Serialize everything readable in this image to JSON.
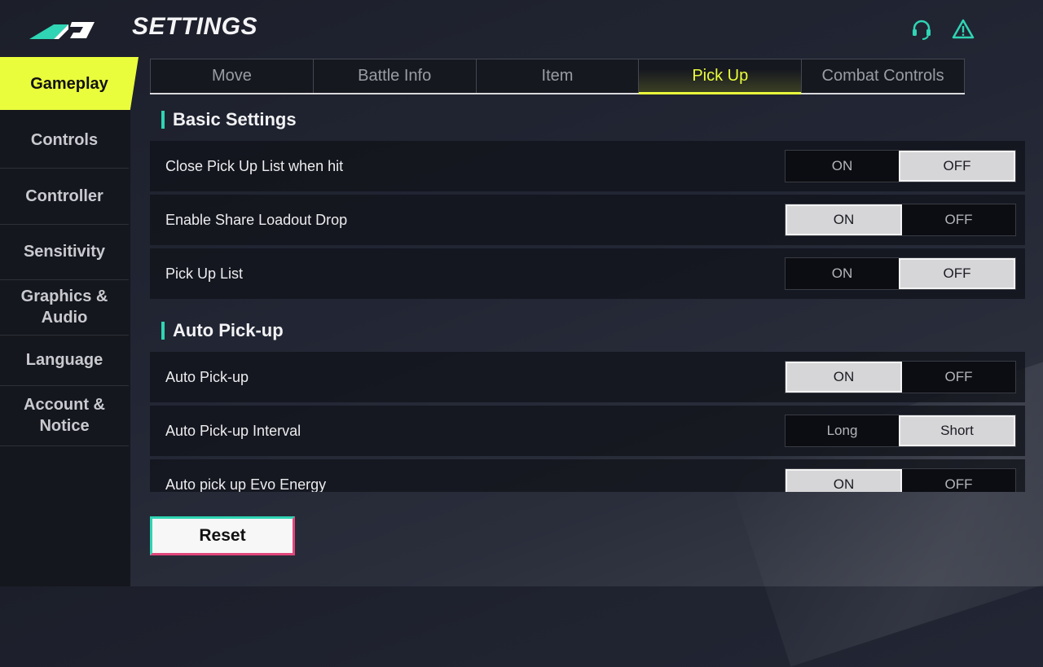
{
  "header": {
    "title": "SETTINGS",
    "icons": [
      "logo",
      "headset-icon",
      "alert-triangle-icon"
    ]
  },
  "sidebar": {
    "items": [
      {
        "label": "Gameplay",
        "active": true
      },
      {
        "label": "Controls"
      },
      {
        "label": "Controller"
      },
      {
        "label": "Sensitivity"
      },
      {
        "label": "Graphics &\nAudio"
      },
      {
        "label": "Language"
      },
      {
        "label": "Account &\nNotice"
      }
    ]
  },
  "tabs": [
    {
      "label": "Move"
    },
    {
      "label": "Battle Info"
    },
    {
      "label": "Item"
    },
    {
      "label": "Pick Up",
      "active": true
    },
    {
      "label": "Combat Controls"
    }
  ],
  "sections": {
    "basic": {
      "title": "Basic Settings",
      "rows": [
        {
          "label": "Close Pick Up List when hit",
          "options": [
            "ON",
            "OFF"
          ],
          "selected": "OFF"
        },
        {
          "label": "Enable Share Loadout Drop",
          "options": [
            "ON",
            "OFF"
          ],
          "selected": "ON"
        },
        {
          "label": "Pick Up List",
          "options": [
            "ON",
            "OFF"
          ],
          "selected": "OFF"
        }
      ]
    },
    "auto": {
      "title": "Auto Pick-up",
      "rows": [
        {
          "label": "Auto Pick-up",
          "options": [
            "ON",
            "OFF"
          ],
          "selected": "ON"
        },
        {
          "label": "Auto Pick-up Interval",
          "options": [
            "Long",
            "Short"
          ],
          "selected": "Short"
        },
        {
          "label": "Auto pick up Evo Energy",
          "options": [
            "ON",
            "OFF"
          ],
          "selected": "ON"
        }
      ]
    }
  },
  "reset_label": "Reset",
  "colors": {
    "accent_yellow": "#eafd3c",
    "accent_teal": "#2fd5b4",
    "accent_pink": "#e0467a"
  }
}
